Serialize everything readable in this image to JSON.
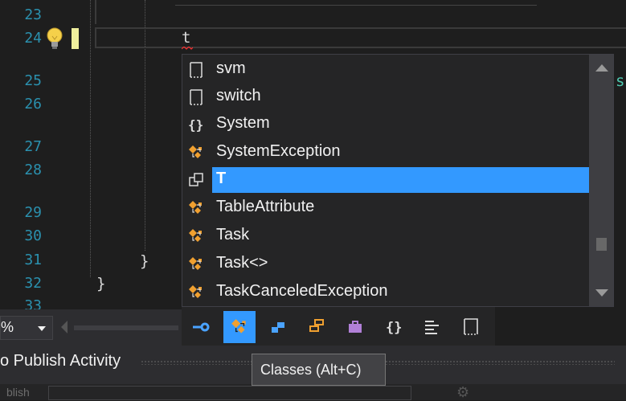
{
  "editor": {
    "line_numbers": [
      "23",
      "24",
      "25",
      "26",
      "27",
      "28",
      "29",
      "30",
      "31",
      "32",
      "33"
    ],
    "typed_text": "t",
    "closing_brace_inner": "}",
    "closing_brace_outer": "}",
    "right_edge_char": "s"
  },
  "completion": {
    "items": [
      {
        "label": "svm",
        "icon": "snippet-icon"
      },
      {
        "label": "switch",
        "icon": "snippet-icon"
      },
      {
        "label": "System",
        "icon": "namespace-icon"
      },
      {
        "label": "SystemException",
        "icon": "class-icon"
      },
      {
        "label": "T",
        "icon": "type-parameter-icon",
        "selected": true
      },
      {
        "label": "TableAttribute",
        "icon": "class-icon"
      },
      {
        "label": "Task",
        "icon": "class-icon"
      },
      {
        "label": "Task<>",
        "icon": "class-icon"
      },
      {
        "label": "TaskCanceledException",
        "icon": "class-icon"
      }
    ],
    "filters": [
      {
        "name": "properties-filter-icon",
        "active": false
      },
      {
        "name": "classes-filter-icon",
        "active": true
      },
      {
        "name": "interfaces-filter-icon",
        "active": false
      },
      {
        "name": "structures-filter-icon",
        "active": false
      },
      {
        "name": "modules-filter-icon",
        "active": false
      },
      {
        "name": "namespaces-filter-icon",
        "active": false
      },
      {
        "name": "enums-filter-icon",
        "active": false
      },
      {
        "name": "snippets-filter-icon",
        "active": false
      }
    ],
    "tooltip": "Classes (Alt+C)"
  },
  "status": {
    "zoom_fragment": "%"
  },
  "panel": {
    "title_fragment": "o Publish Activity",
    "sub_label_fragment": "blish"
  },
  "colors": {
    "selection": "#3399ff",
    "line_number": "#2b91af",
    "class_icon": "#f0a030"
  }
}
